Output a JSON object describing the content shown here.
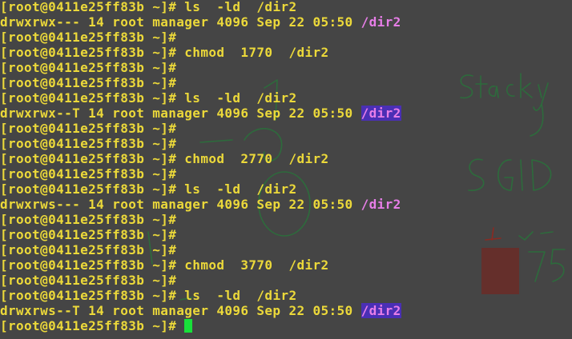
{
  "terminal": {
    "lines": [
      {
        "prompt": "[root@0411e25ff83b ~]# ",
        "cmd": "ls  -ld  /dir2"
      },
      {
        "perm": "drwxrwx--- 14 root manager 4096 Sep 22 05:50 ",
        "dir": "/dir2",
        "hl": false
      },
      {
        "prompt": "[root@0411e25ff83b ~]#",
        "cmd": ""
      },
      {
        "prompt": "[root@0411e25ff83b ~]# ",
        "cmd": "chmod  1770  /dir2"
      },
      {
        "prompt": "[root@0411e25ff83b ~]#",
        "cmd": ""
      },
      {
        "prompt": "[root@0411e25ff83b ~]#",
        "cmd": ""
      },
      {
        "prompt": "[root@0411e25ff83b ~]# ",
        "cmd": "ls  -ld  /dir2"
      },
      {
        "perm": "drwxrwx--T 14 root manager 4096 Sep 22 05:50 ",
        "dir": "/dir2",
        "hl": true
      },
      {
        "prompt": "[root@0411e25ff83b ~]#",
        "cmd": ""
      },
      {
        "prompt": "[root@0411e25ff83b ~]#",
        "cmd": ""
      },
      {
        "prompt": "[root@0411e25ff83b ~]# ",
        "cmd": "chmod  2770  /dir2"
      },
      {
        "prompt": "[root@0411e25ff83b ~]#",
        "cmd": ""
      },
      {
        "prompt": "[root@0411e25ff83b ~]# ",
        "cmd": "ls  -ld  /dir2"
      },
      {
        "perm": "drwxrws--- 14 root manager 4096 Sep 22 05:50 ",
        "dir": "/dir2",
        "hl": false
      },
      {
        "prompt": "[root@0411e25ff83b ~]#",
        "cmd": ""
      },
      {
        "prompt": "[root@0411e25ff83b ~]#",
        "cmd": ""
      },
      {
        "prompt": "[root@0411e25ff83b ~]#",
        "cmd": ""
      },
      {
        "prompt": "[root@0411e25ff83b ~]# ",
        "cmd": "chmod  3770  /dir2"
      },
      {
        "prompt": "[root@0411e25ff83b ~]#",
        "cmd": ""
      },
      {
        "prompt": "[root@0411e25ff83b ~]# ",
        "cmd": "ls  -ld  /dir2"
      },
      {
        "perm": "drwxrws--T 14 root manager 4096 Sep 22 05:50 ",
        "dir": "/dir2",
        "hl": true
      },
      {
        "prompt": "[root@0411e25ff83b ~]# ",
        "cmd": "",
        "cursor": true
      }
    ]
  },
  "colors": {
    "background": "#454545",
    "text": "#ecd93a",
    "directory": "#e77ee8",
    "directory_highlight_bg": "#4a2fb5",
    "cursor": "#18e03a",
    "annotation_ink": "#2d6b3c",
    "annotation_red": "#8a2a22"
  }
}
